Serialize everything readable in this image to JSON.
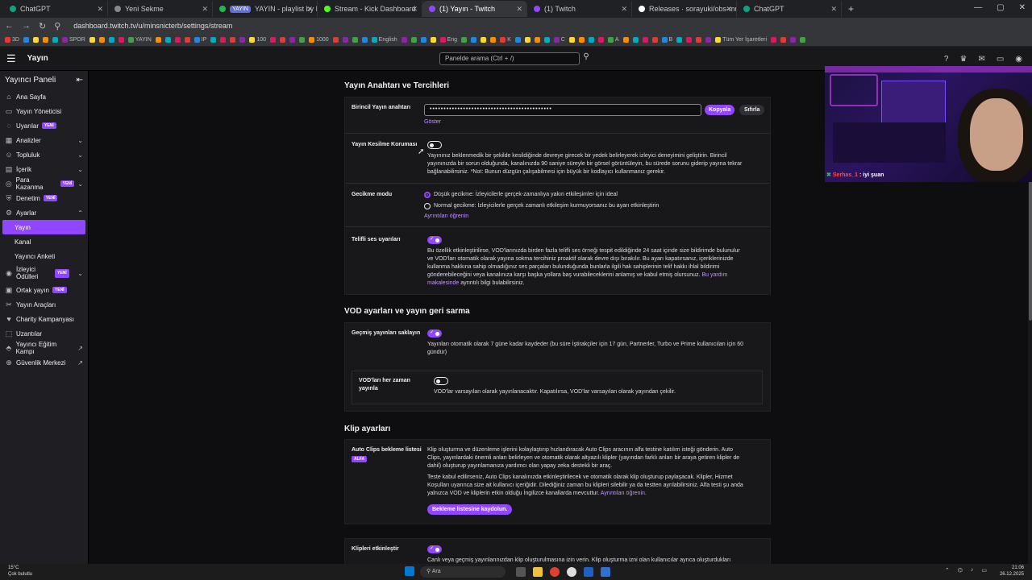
{
  "browser": {
    "tabs": [
      {
        "label": "ChatGPT",
        "color": "#10a37f"
      },
      {
        "label": "Yeni Sekme",
        "color": "#888888"
      },
      {
        "label": "YAYIN - playlist by Minsnicterb",
        "color": "#1db954",
        "badge": "YAYIN"
      },
      {
        "label": "Stream - Kick Dashboard",
        "color": "#53fc18"
      },
      {
        "label": "(1) Yayın - Twitch",
        "color": "#9147ff",
        "active": true
      },
      {
        "label": "(1) Twitch",
        "color": "#9147ff"
      },
      {
        "label": "Releases · sorayuki/obs-multi-",
        "color": "#ffffff"
      },
      {
        "label": "ChatGPT",
        "color": "#10a37f"
      }
    ],
    "url": "dashboard.twitch.tv/u/minsnicterb/settings/stream",
    "bookmarks": [
      "3D",
      "SPOR",
      "YAYIN",
      "IP",
      "100",
      "1000",
      "English",
      "Eng",
      "K",
      "C",
      "A",
      "B",
      "Tüm Yer İşaretleri"
    ]
  },
  "topnav": {
    "title": "Yayın",
    "search_placeholder": "Panelde arama (Ctrl + /)",
    "notif_count": "1"
  },
  "sidebar": {
    "header": "Yayıncı Paneli",
    "new_badge": "YENİ",
    "items": [
      {
        "label": "Ana Sayfa",
        "icon": "⌂"
      },
      {
        "label": "Yayın Yöneticisi",
        "icon": "▭"
      },
      {
        "label": "Uyarılar",
        "icon": "◌",
        "new": true
      },
      {
        "label": "Analizler",
        "icon": "▦",
        "chev": "⌄"
      },
      {
        "label": "Topluluk",
        "icon": "☺",
        "chev": "⌄"
      },
      {
        "label": "İçerik",
        "icon": "▤",
        "chev": "⌄"
      },
      {
        "label": "Para Kazanma",
        "icon": "◎",
        "chev": "⌄",
        "new": true
      },
      {
        "label": "Denetim",
        "icon": "⛨",
        "new": true
      },
      {
        "label": "Ayarlar",
        "icon": "⚙",
        "chev": "⌃"
      },
      {
        "label": "Yayın",
        "sub": true,
        "selected": true
      },
      {
        "label": "Kanal",
        "sub": true
      },
      {
        "label": "Yayıncı Anketi",
        "sub": true
      },
      {
        "label": "İzleyici Ödülleri",
        "icon": "◉",
        "chev": "⌄",
        "new": true
      },
      {
        "label": "Ortak yayın",
        "icon": "▣",
        "new": true
      },
      {
        "label": "Yayın Araçları",
        "icon": "✂"
      },
      {
        "label": "Charity Kampanyası",
        "icon": "♥"
      },
      {
        "label": "Uzantılar",
        "icon": "⬚"
      },
      {
        "label": "Yayıncı Eğitim Kampı",
        "icon": "⬘",
        "ext": "↗"
      },
      {
        "label": "Güvenlik Merkezi",
        "icon": "⊕",
        "ext": "↗"
      }
    ]
  },
  "section1": {
    "title": "Yayın Anahtarı ve Tercihleri",
    "key_label": "Birincil Yayın anahtarı",
    "key_value": "••••••••••••••••••••••••••••••••••••••••••••",
    "copy_btn": "Kopyala",
    "reset_btn": "Sıfırla",
    "show_link": "Göster",
    "disconnect_label": "Yayın Kesilme Koruması",
    "disconnect_text_1": "Yayınınız beklenmedik bir şekilde kesildiğinde devreye girecek bir yedek belirleyerek izleyici deneyimini geliştirin. Birincil",
    "disconnect_text_2": "yayınınızda bir sorun olduğunda, kanalınızda 90 saniye süreyle bir görsel görüntüleyin, bu sürede sorunu giderip yayına tekrar",
    "disconnect_text_3": "bağlanabilirsiniz. *Not: Bunun düzgün çalışabilmesi için büyük bir kodlayıcı kullanmanız gerekir.",
    "latency_label": "Gecikme modu",
    "latency_low": "Düşük gecikme: İzleyicilerle gerçek-zamanlıya yakın etkileşimler için ideal",
    "latency_normal": "Normal gecikme: İzleyicilerle gerçek zamanlı etkileşim kurmuyorsanız bu ayarı etkinleştirin",
    "learn_more": "Ayrıntıları öğrenin",
    "copyright_label": "Telifli ses uyarıları",
    "copyright_1": "Bu özellik etkinleştirilirse, VOD'larınızda birden fazla telifli ses örneği tespit edildiğinde 24 saat içinde size bildirimde bulunulur",
    "copyright_2": "ve VOD'ları otomatik olarak yayına sokma tercihiniz proaktif olarak devre dışı bırakılır. Bu ayarı kapatırsanız, içeriklerinizde",
    "copyright_3": "kullanma hakkına sahip olmadığınız ses parçaları bulunduğunda bunlarla ilgili hak sahiplerinin telif hakkı ihlal bildirimi",
    "copyright_4": "gönderebileceğini veya kanalınıza karşı başka yollara baş vurabileceklerini anlamış ve kabul etmiş olursunuz.",
    "copyright_link_1": "Bu yardım",
    "copyright_link_2": "makalesinde",
    "copyright_tail": "ayrıntılı bilgi bulabilirsiniz."
  },
  "section2": {
    "title": "VOD ayarları ve yayın geri sarma",
    "store_label": "Geçmiş yayınları saklayın",
    "store_1": "Yayınları otomatik olarak 7 güne kadar kaydeder (bu süre İştirakçiler için 17 gün, Partnerler, Turbo ve Prime kullanıcıları için 60",
    "store_2": "gündür)",
    "publish_label_1": "VOD'ları her zaman",
    "publish_label_2": "yayınla",
    "publish_text": "VOD'lar varsayılan olarak yayınlanacaktır. Kapatılırsa, VOD'lar varsayılan olarak yayından çekilir."
  },
  "section3": {
    "title": "Klip ayarları",
    "auto_label": "Auto Clips bekleme listesi",
    "alfa": "ALFA",
    "auto_1": "Klip oluşturma ve düzenleme işlerini kolaylaştırıp hızlandıracak Auto Clips aracının alfa testine katılım isteği gönderin. Auto",
    "auto_2": "Clips, yayınlardaki önemli anları belirleyen ve otomatik olarak altyazılı klipler (yayından farklı anları bir araya getiren klipler de",
    "auto_3": "dahil) oluşturup yayınlamanıza yardımcı olan yapay zeka destekli bir araç.",
    "auto_4": "Teste kabul edilirseniz, Auto Clips kanalınızda etkinleştirilecek ve otomatik olarak klip oluşturup paylaşacak. Klipler, Hizmet",
    "auto_5": "Koşulları uyarınca size ait kullanıcı içeriğidir. Dilediğiniz zaman bu klipleri silebilir ya da testten ayrılabilirsiniz. Alfa testi şu anda",
    "auto_6": "yalnızca VOD ve kliplerin etkin olduğu İngilizce kanallarda mevcuttur.",
    "auto_link": "Ayrıntıları öğrenin.",
    "join_btn": "Bekleme listesine kaydolun.",
    "enable_label": "Klipleri etkinleştir",
    "enable_text": "Canlı veya geçmiş yayınlarınızdan klip oluşturulmasına izin verin. Klip oluşturma izni olan kullanıcılar ayrıca oluşturdukları"
  },
  "webcam": {
    "chat_user": "Serhas_1",
    "chat_msg": ": iyi şuan"
  },
  "taskbar": {
    "temp": "15°C",
    "weather": "Çok bulutlu",
    "search": "Ara",
    "time": "21:06",
    "date": "26.12.2025"
  }
}
